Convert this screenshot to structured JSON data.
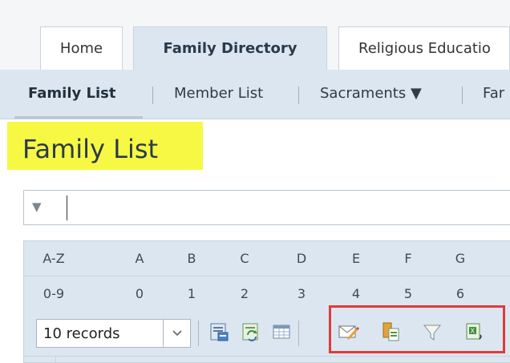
{
  "tabs": [
    {
      "label": "Home"
    },
    {
      "label": "Family Directory"
    },
    {
      "label": "Religious Educatio"
    }
  ],
  "subnav": {
    "items": [
      {
        "label": "Family List"
      },
      {
        "label": "Member List"
      },
      {
        "label": "Sacraments ▼"
      },
      {
        "label": "Far"
      }
    ]
  },
  "page_title": "Family List",
  "filter": {
    "arrow": "▼",
    "value": ""
  },
  "letters_row1": [
    "A-Z",
    "A",
    "B",
    "C",
    "D",
    "E",
    "F",
    "G"
  ],
  "letters_row2": [
    "0-9",
    "0",
    "1",
    "2",
    "3",
    "4",
    "5",
    "6"
  ],
  "toolbar": {
    "records_label": "10 records",
    "dropdown_icon": "chevron-down-icon",
    "icons": [
      "export-icon",
      "refresh-icon",
      "columns-icon",
      "email-icon",
      "copy-icon",
      "filter-icon",
      "excel-icon"
    ],
    "highlight_color": "#e23a3a"
  },
  "colors": {
    "title_highlight": "#f6f844",
    "nav_bg": "#dbe6f0"
  }
}
